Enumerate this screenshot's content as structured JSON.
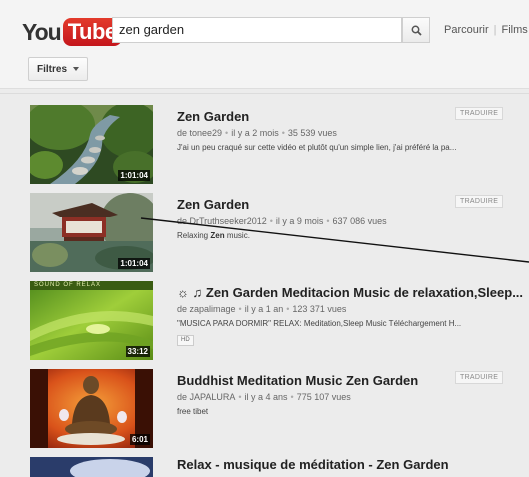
{
  "header": {
    "logo_you": "You",
    "logo_tube": "Tube",
    "search_value": "zen garden",
    "links": [
      "Parcourir",
      "Films"
    ],
    "filters_label": "Filtres"
  },
  "results": [
    {
      "title": "Zen Garden",
      "meta": [
        "de tonee29",
        "il y a 2 mois",
        "35 539 vues"
      ],
      "desc": "J'ai un peu craqué sur cette vidéo et plutôt qu'un simple lien, j'ai préféré la pa...",
      "duration": "1:01:04",
      "translate": "TRADUIRE"
    },
    {
      "title": "Zen Garden",
      "meta": [
        "de DrTruthseeker2012",
        "il y a 9 mois",
        "637 086 vues"
      ],
      "desc_pre": "Relaxing ",
      "desc_bold": "Zen",
      "desc_post": " music.",
      "duration": "1:01:04",
      "translate": "TRADUIRE"
    },
    {
      "title": "☼ ♫ Zen Garden Meditacion Music de relaxation,Sleep...",
      "meta": [
        "de zapalimage",
        "il y a 1 an",
        "123 371 vues"
      ],
      "desc": "\"MUSICA PARA DORMIR\" RELAX: Meditation,Sleep Music Téléchargement H...",
      "duration": "33:12",
      "badge": "HD",
      "thumb_text": "SOUND OF RELAX"
    },
    {
      "title": "Buddhist Meditation Music Zen Garden",
      "meta": [
        "de JAPALURA",
        "il y a 4 ans",
        "775 107 vues"
      ],
      "desc": "free tibet",
      "duration": "6:01",
      "translate": "TRADUIRE"
    },
    {
      "title": "Relax - musique de méditation - Zen Garden"
    }
  ]
}
